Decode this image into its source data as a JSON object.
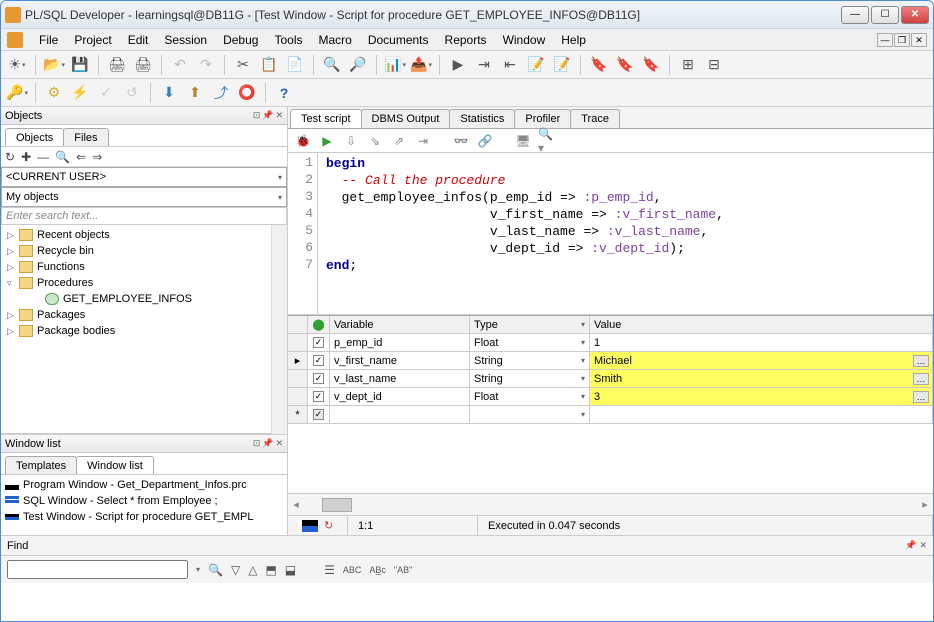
{
  "title": "PL/SQL Developer - learningsql@DB11G - [Test Window - Script for procedure GET_EMPLOYEE_INFOS@DB11G]",
  "menu": [
    "File",
    "Project",
    "Edit",
    "Session",
    "Debug",
    "Tools",
    "Macro",
    "Documents",
    "Reports",
    "Window",
    "Help"
  ],
  "objects": {
    "title": "Objects",
    "tabs": {
      "objects": "Objects",
      "files": "Files"
    },
    "toolbar_icons": [
      "↻",
      "✚",
      "—",
      "🔍",
      "⇐",
      "⇒"
    ],
    "schema": "<CURRENT USER>",
    "filter": "My objects",
    "search_placeholder": "Enter search text...",
    "tree": [
      {
        "label": "Recent objects",
        "exp": "▷",
        "icon": "folder"
      },
      {
        "label": "Recycle bin",
        "exp": "▷",
        "icon": "folder"
      },
      {
        "label": "Functions",
        "exp": "▷",
        "icon": "folder"
      },
      {
        "label": "Procedures",
        "exp": "▿",
        "icon": "folder-open"
      },
      {
        "label": "GET_EMPLOYEE_INFOS",
        "indent": 2,
        "icon": "proc"
      },
      {
        "label": "Packages",
        "exp": "▷",
        "icon": "folder"
      },
      {
        "label": "Package bodies",
        "exp": "▷",
        "icon": "folder"
      }
    ]
  },
  "winlist": {
    "title": "Window list",
    "tabs": {
      "templates": "Templates",
      "windowlist": "Window list"
    },
    "items": [
      {
        "icon": "prog",
        "label": "Program Window - Get_Department_Infos.prc"
      },
      {
        "icon": "sql",
        "label": "SQL Window - Select * from Employee ;"
      },
      {
        "icon": "test",
        "label": "Test Window - Script for procedure GET_EMPL"
      }
    ]
  },
  "result_tabs": [
    "Test script",
    "DBMS Output",
    "Statistics",
    "Profiler",
    "Trace"
  ],
  "code": {
    "lines": [
      "1",
      "2",
      "3",
      "4",
      "5",
      "6",
      "7"
    ]
  },
  "vars_header": {
    "variable": "Variable",
    "type": "Type",
    "value": "Value"
  },
  "vars": [
    {
      "marker": "",
      "chk": true,
      "name": "p_emp_id",
      "type": "Float",
      "value": "1",
      "hl": false
    },
    {
      "marker": "▸",
      "chk": true,
      "name": "v_first_name",
      "type": "String",
      "value": "Michael",
      "hl": true
    },
    {
      "marker": "",
      "chk": true,
      "name": "v_last_name",
      "type": "String",
      "value": "Smith",
      "hl": true
    },
    {
      "marker": "",
      "chk": true,
      "name": "v_dept_id",
      "type": "Float",
      "value": "3",
      "hl": true
    },
    {
      "marker": "*",
      "chk": true,
      "name": "",
      "type": "",
      "value": "",
      "hl": false,
      "disabled": true
    }
  ],
  "status": {
    "pos": "1:1",
    "msg": "Executed in 0.047 seconds",
    "reload": "↻"
  },
  "find": {
    "label": "Find",
    "toolbar": [
      "🔍",
      "▽",
      "△",
      "⬒",
      "⬓",
      "",
      "☰",
      "ABC",
      "AB̲c",
      "\"AB\""
    ]
  }
}
